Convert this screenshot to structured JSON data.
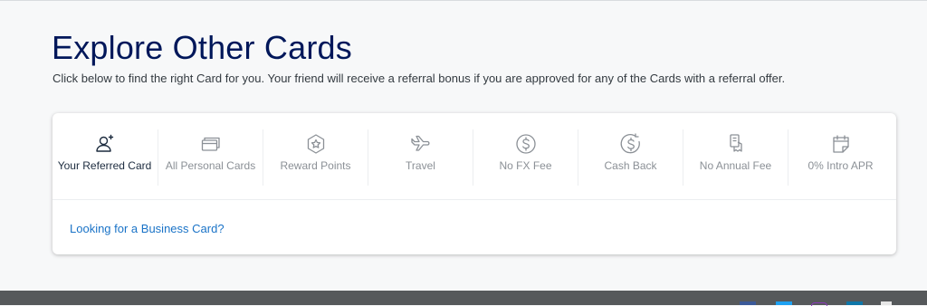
{
  "header": {
    "title": "Explore Other Cards",
    "subtitle": "Click below to find the right Card for you. Your friend will receive a referral bonus if you are approved for any of the Cards with a referral offer."
  },
  "tabs": [
    {
      "label": "Your Referred Card",
      "icon": "user-star-icon",
      "active": true
    },
    {
      "label": "All Personal Cards",
      "icon": "cards-stack-icon",
      "active": false
    },
    {
      "label": "Reward Points",
      "icon": "star-badge-icon",
      "active": false
    },
    {
      "label": "Travel",
      "icon": "airplane-icon",
      "active": false
    },
    {
      "label": "No FX Fee",
      "icon": "dollar-circle-icon",
      "active": false
    },
    {
      "label": "Cash Back",
      "icon": "cash-back-icon",
      "active": false
    },
    {
      "label": "No Annual Fee",
      "icon": "no-fee-icon",
      "active": false
    },
    {
      "label": "0% Intro APR",
      "icon": "calendar-icon",
      "active": false
    }
  ],
  "business_link": "Looking for a Business Card?",
  "colors": {
    "title": "#00175a",
    "link": "#1a73c7",
    "active_icon": "#1c2b3e",
    "inactive_icon": "#8b9096",
    "footer": "#56595b"
  },
  "footer": {
    "social_icons": [
      "facebook-icon",
      "twitter-icon",
      "instagram-icon",
      "linkedin-icon",
      "youtube-icon"
    ]
  }
}
